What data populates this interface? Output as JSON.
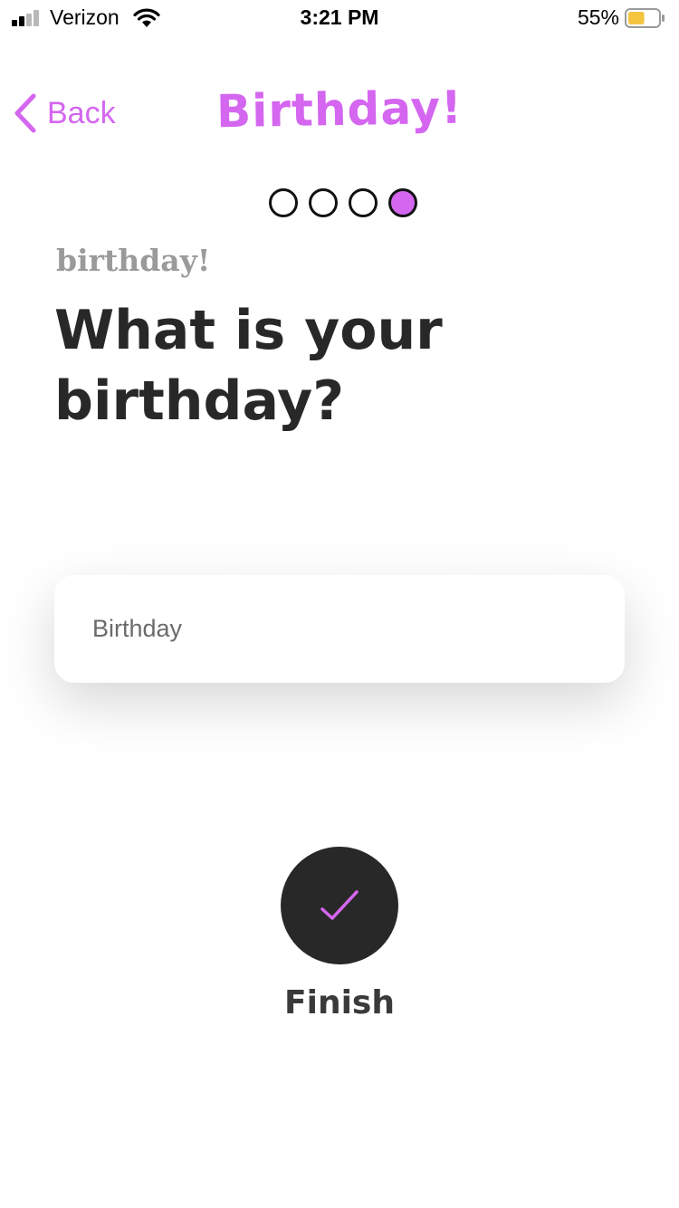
{
  "status_bar": {
    "carrier": "Verizon",
    "time": "3:21 PM",
    "battery_percent": "55%",
    "battery_level": 0.55,
    "signal_bars": 2
  },
  "nav": {
    "back_label": "Back",
    "title": "Birthday!"
  },
  "progress": {
    "total_steps": 4,
    "current_step": 4
  },
  "question": {
    "eyebrow": "birthday!",
    "text": "What is your birthday?"
  },
  "birthday_input": {
    "value": "",
    "placeholder": "Birthday"
  },
  "finish": {
    "label": "Finish",
    "icon": "checkmark-icon"
  },
  "colors": {
    "accent": "#d466f0",
    "dark": "#282828",
    "muted": "#9a9a9a",
    "battery": "#f5c542"
  }
}
